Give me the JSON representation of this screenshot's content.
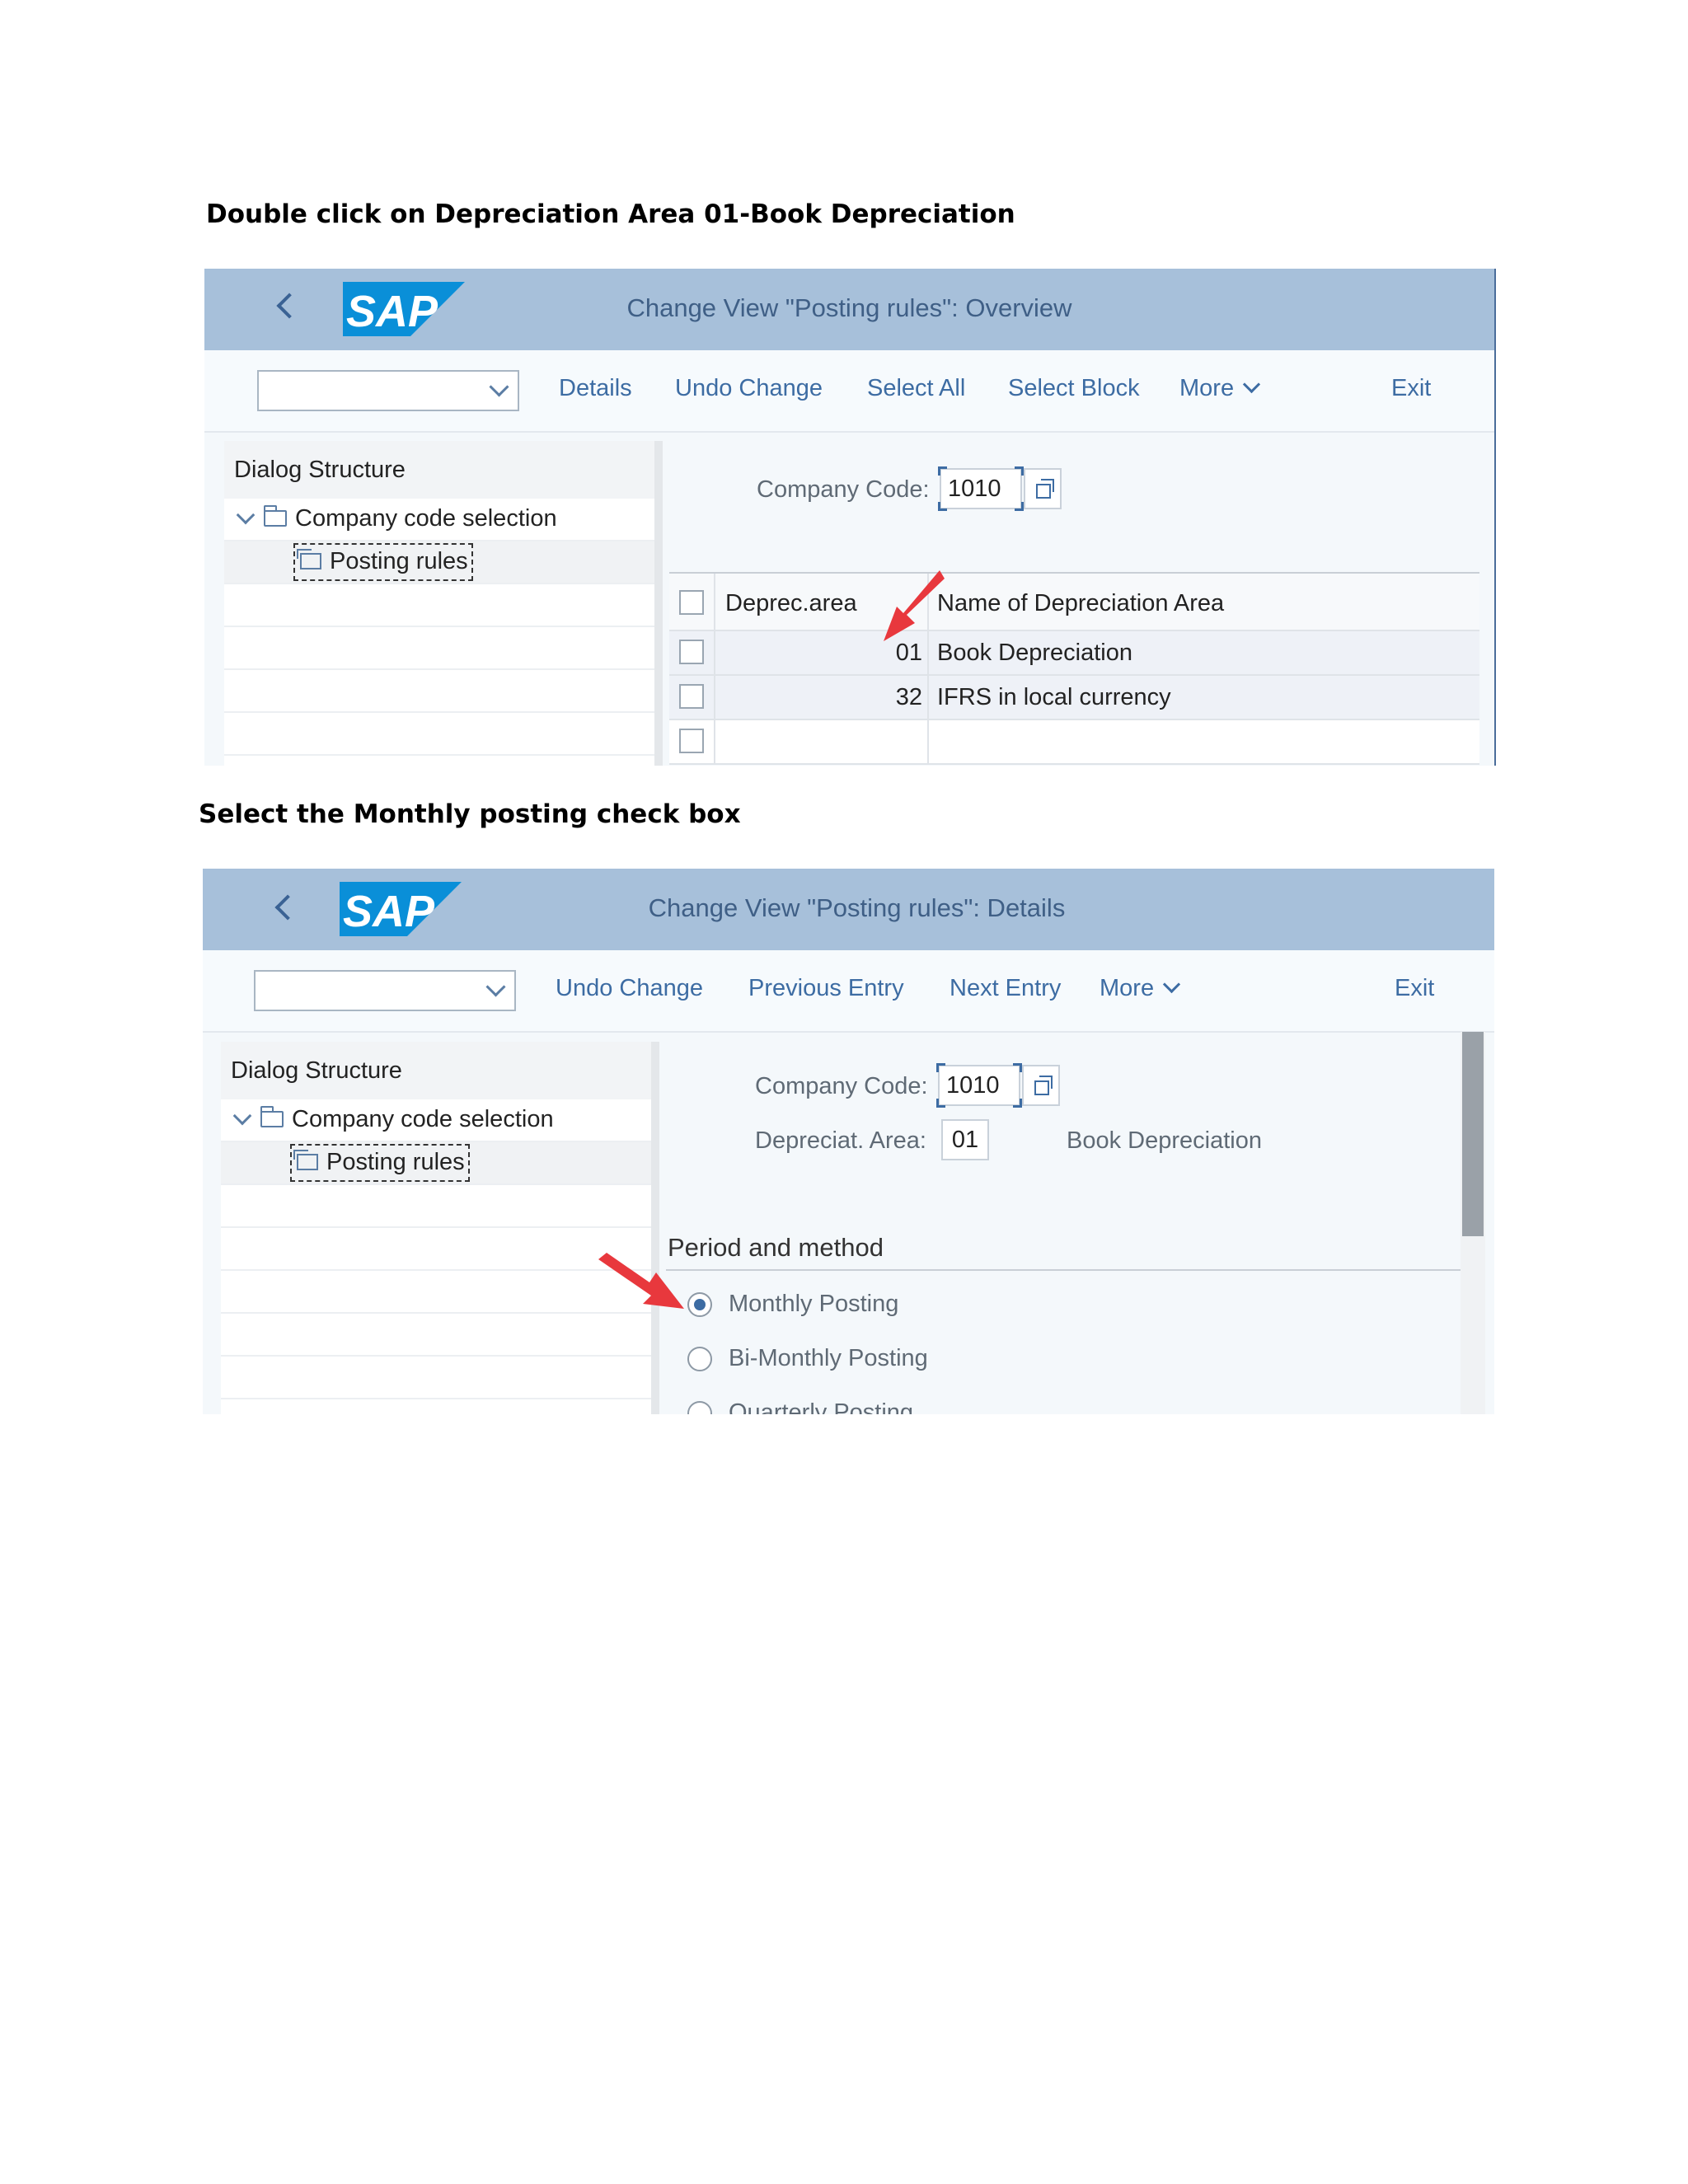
{
  "instructions": {
    "step1": "Double click on Depreciation Area 01-Book Depreciation",
    "step2": "Select the Monthly posting check box"
  },
  "brand": {
    "logo_text": "SAP",
    "logo_color": "#0a8fd8",
    "header_color": "#a7c0da"
  },
  "screen1": {
    "title": "Change View \"Posting rules\": Overview",
    "toolbar": [
      "Details",
      "Undo Change",
      "Select All",
      "Select Block",
      "More"
    ],
    "exit": "Exit",
    "dialog_structure": {
      "header": "Dialog Structure",
      "node": "Company code selection",
      "child": "Posting rules"
    },
    "company_code_label": "Company Code:",
    "company_code_value": "1010",
    "table": {
      "columns": [
        "Deprec.area",
        "Name of Depreciation Area"
      ],
      "rows": [
        {
          "area": "01",
          "name": "Book Depreciation"
        },
        {
          "area": "32",
          "name": "IFRS in local currency"
        }
      ]
    }
  },
  "screen2": {
    "title": "Change View \"Posting rules\": Details",
    "toolbar": [
      "Undo Change",
      "Previous Entry",
      "Next Entry",
      "More"
    ],
    "exit": "Exit",
    "dialog_structure": {
      "header": "Dialog Structure",
      "node": "Company code selection",
      "child": "Posting rules"
    },
    "company_code_label": "Company Code:",
    "company_code_value": "1010",
    "deprec_area_label": "Depreciat. Area:",
    "deprec_area_value": "01",
    "deprec_area_name": "Book Depreciation",
    "section": "Period and method",
    "options": [
      {
        "label": "Monthly Posting",
        "selected": true
      },
      {
        "label": "Bi-Monthly Posting",
        "selected": false
      },
      {
        "label": "Quarterly Posting",
        "selected": false
      }
    ]
  }
}
